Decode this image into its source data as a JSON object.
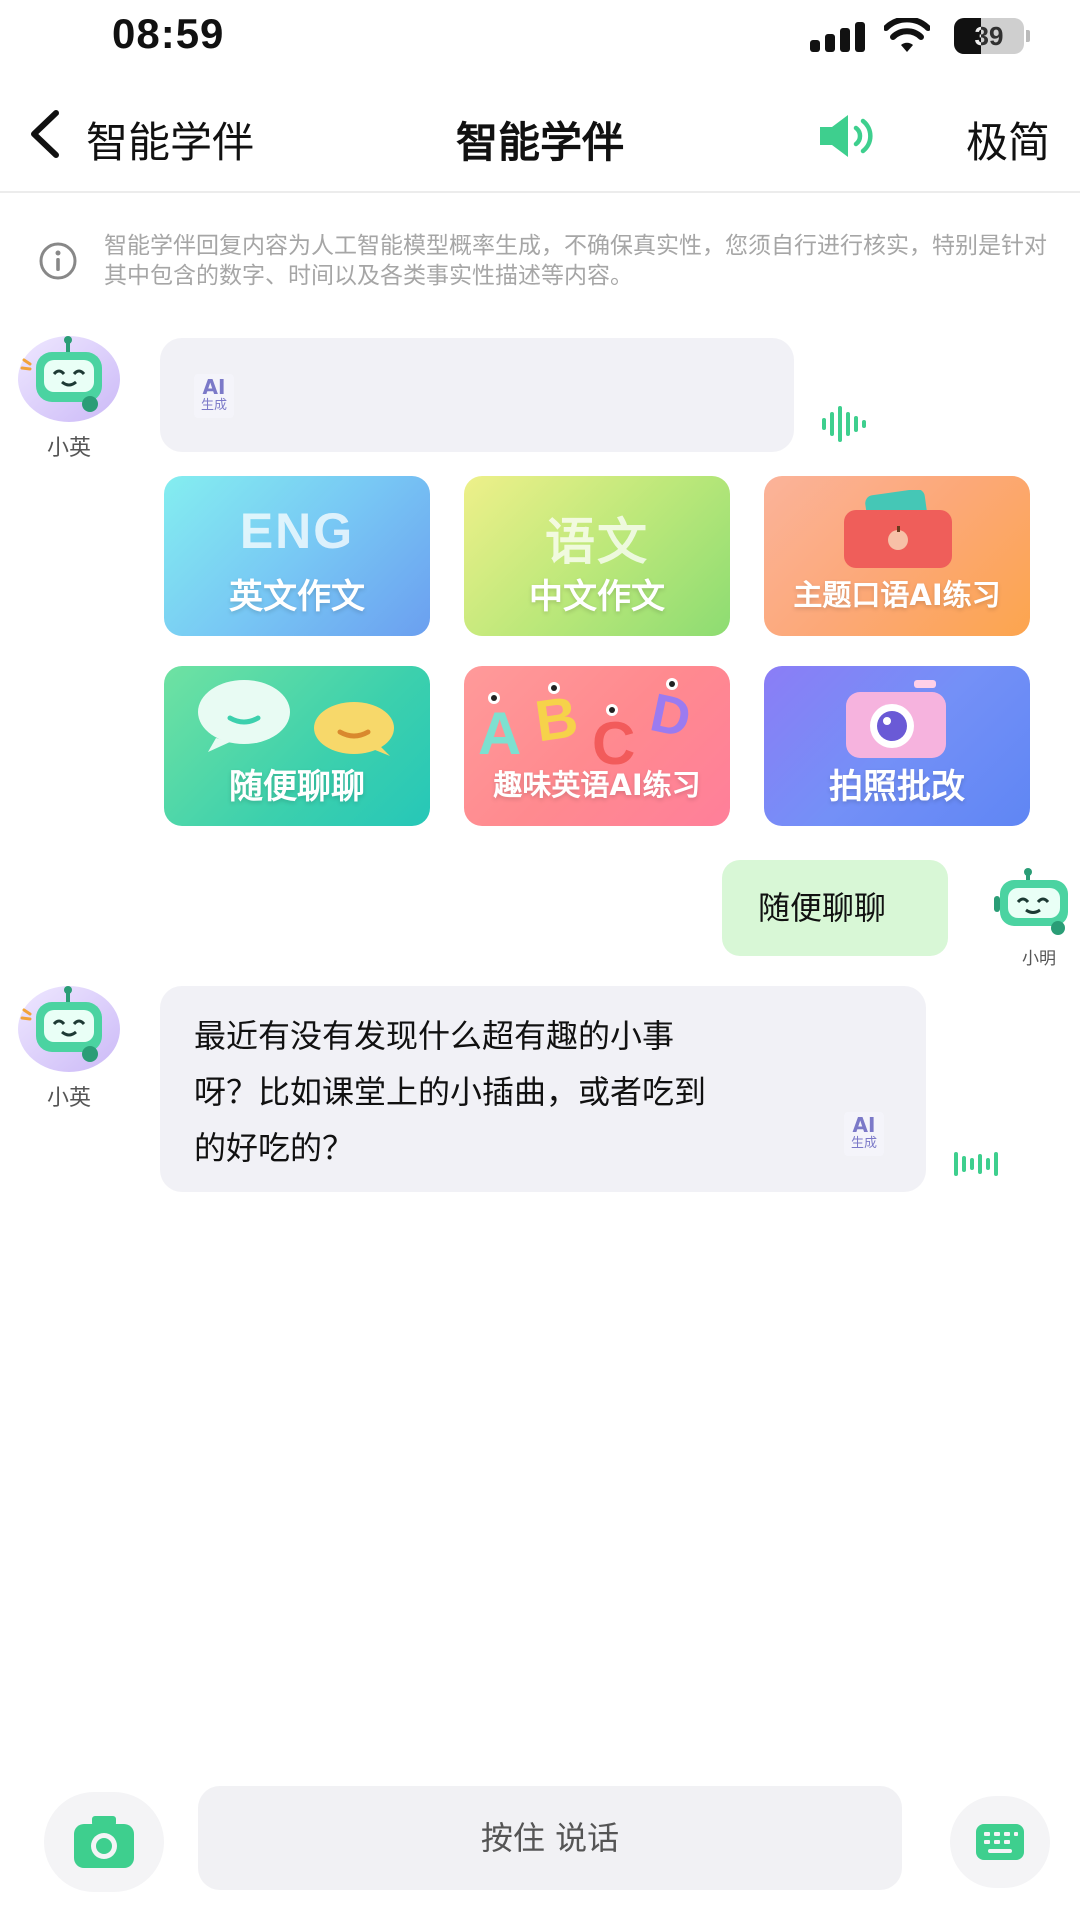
{
  "status_bar": {
    "time": "08:59",
    "battery_level": "39"
  },
  "nav": {
    "back_label": "智能学伴",
    "title": "智能学伴",
    "mode_label": "极简"
  },
  "disclaimer": {
    "text": "智能学伴回复内容为人工智能模型概率生成，不确保真实性，您须自行进行核实，特别是针对其中包含的数字、时间以及各类事实性描述等内容。"
  },
  "ai_badge": {
    "top": "AI",
    "bottom": "生成"
  },
  "bot": {
    "name": "小英"
  },
  "user": {
    "name": "小明"
  },
  "cards": [
    {
      "label": "英文作文",
      "deco": "ENG"
    },
    {
      "label": "中文作文",
      "deco": "语文"
    },
    {
      "label": "主题口语AI练习"
    },
    {
      "label": "随便聊聊"
    },
    {
      "label": "趣味英语AI练习",
      "deco": "ABCD"
    },
    {
      "label": "拍照批改"
    }
  ],
  "messages": {
    "user_reply": "随便聊聊",
    "bot_reply_lines": [
      "最近有没有发现什么超有趣的小事",
      "呀？比如课堂上的小插曲，或者吃到",
      "的好吃的？"
    ]
  },
  "bottom_bar": {
    "hold_to_talk": "按住 说话"
  },
  "colors": {
    "accent_green": "#3ecf8e",
    "bubble_gray": "#f1f1f6",
    "user_bubble": "#d8f7d6",
    "ai_badge": "#7b79c8"
  }
}
